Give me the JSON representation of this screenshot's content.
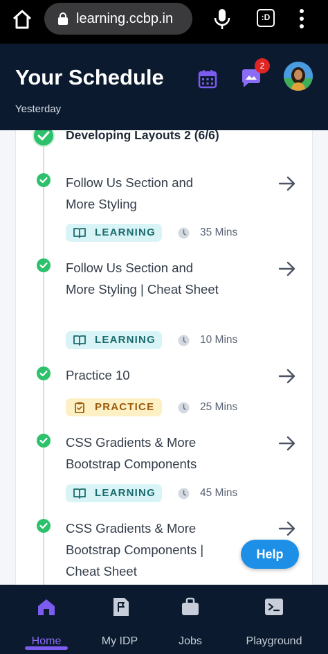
{
  "browser": {
    "url": "learning.ccbp.in",
    "icons": [
      "home-icon",
      "lock-icon",
      "mic-icon",
      "tabs-icon",
      "more-vertical-icon"
    ],
    "tab_label": ":D"
  },
  "header": {
    "title": "Your Schedule",
    "subtitle": "Yesterday",
    "notification_count": "2",
    "icons": [
      "calendar-icon",
      "chat-icon",
      "avatar"
    ]
  },
  "section": {
    "title": "Developing Layouts 2 (6/6)"
  },
  "items": [
    {
      "title": "Follow Us Section and More Styling",
      "tag": "LEARNING",
      "duration": "35 Mins"
    },
    {
      "title": "Follow Us Section and More Styling | Cheat Sheet",
      "tag": "LEARNING",
      "duration": "10 Mins"
    },
    {
      "title": "Practice 10",
      "tag": "PRACTICE",
      "duration": "25 Mins"
    },
    {
      "title": "CSS Gradients & More Bootstrap Components",
      "tag": "LEARNING",
      "duration": "45 Mins"
    },
    {
      "title": "CSS Gradients & More Bootstrap Components | Cheat Sheet"
    }
  ],
  "help_label": "Help",
  "nav": {
    "items": [
      {
        "label": "Home",
        "active": true
      },
      {
        "label": "My IDP"
      },
      {
        "label": "Jobs"
      },
      {
        "label": "Playground"
      }
    ]
  },
  "colors": {
    "header_bg": "#0b1a2e",
    "accent_purple": "#7c5cf0",
    "success_green": "#2ec16c",
    "learning_bg": "#d9f4f6",
    "practice_bg": "#fdf0c4",
    "help_blue": "#1d8fe6"
  }
}
